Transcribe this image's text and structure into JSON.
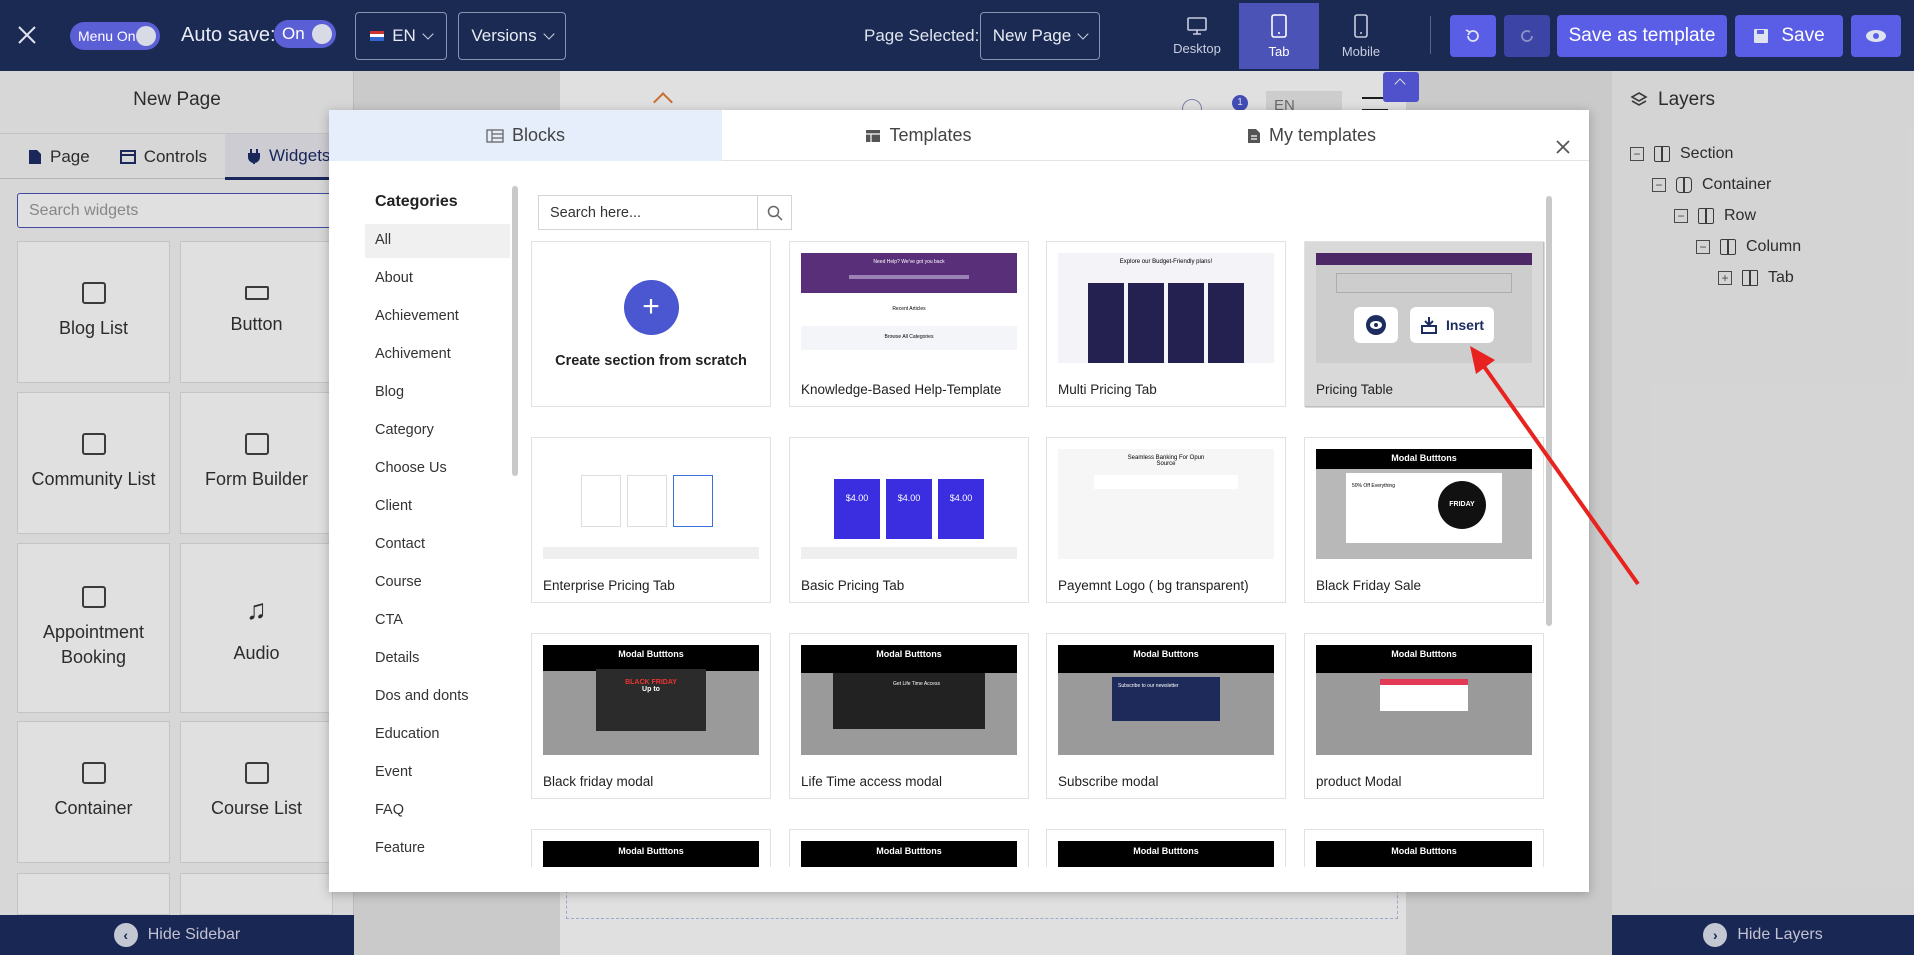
{
  "topbar": {
    "menu_toggle_label": "Menu On",
    "autosave_label": "Auto save:",
    "autosave_value": "On",
    "language": "EN",
    "versions_label": "Versions",
    "page_selected_label": "Page Selected:",
    "page_selected_value": "New Page",
    "devices": [
      {
        "label": "Desktop",
        "active": false
      },
      {
        "label": "Tab",
        "active": true
      },
      {
        "label": "Mobile",
        "active": false
      }
    ],
    "save_template_label": "Save as template",
    "save_label": "Save"
  },
  "left_panel": {
    "title": "New Page",
    "tabs": [
      {
        "label": "Page",
        "active": false
      },
      {
        "label": "Controls",
        "active": false
      },
      {
        "label": "Widgets",
        "active": true
      }
    ],
    "search_placeholder": "Search widgets",
    "widgets": [
      "Blog List",
      "Button",
      "Community List",
      "Form Builder",
      "Appointment Booking",
      "Audio",
      "Container",
      "Course List"
    ],
    "hide_label": "Hide Sidebar"
  },
  "canvas": {
    "notification_count": "1",
    "language_value": "EN"
  },
  "right_panel": {
    "title": "Layers",
    "layers": [
      "Section",
      "Container",
      "Row",
      "Column",
      "Tab"
    ],
    "hide_label": "Hide Layers"
  },
  "modal": {
    "tabs": [
      {
        "label": "Blocks",
        "active": true
      },
      {
        "label": "Templates",
        "active": false
      },
      {
        "label": "My templates",
        "active": false
      }
    ],
    "categories_title": "Categories",
    "categories": [
      "All",
      "About",
      "Achievement",
      "Achivement",
      "Blog",
      "Category",
      "Choose Us",
      "Client",
      "Contact",
      "Course",
      "CTA",
      "Details",
      "Dos and donts",
      "Education",
      "Event",
      "FAQ",
      "Feature"
    ],
    "active_category": "All",
    "search_placeholder": "Search here...",
    "create_label": "Create section from scratch",
    "templates": [
      "Knowledge-Based Help-Template",
      "Multi Pricing Tab",
      "Pricing Table",
      "Enterprise Pricing Tab",
      "Basic Pricing Tab",
      "Payemnt Logo ( bg transparent)",
      "Black Friday Sale",
      "Black friday modal",
      "Life Time access modal",
      "Subscribe modal",
      "product Modal"
    ],
    "insert_label": "Insert",
    "thumb_texts": {
      "help": "Need Help? We've got you back",
      "recent": "Recent Articles",
      "browse": "Browse All Categories",
      "budget": "Explore our Budget-Friendly plans!",
      "price": "$4.00",
      "banking": "Seamless Banking For Opun Source",
      "modal_title": "Modal Butttons",
      "black_friday": "BLACK FRIDAY",
      "friday": "FRIDAY",
      "discount": "50% Off Everything",
      "subscribe": "Subscribe to our newsletter",
      "lifetime": "Get Life Time Access",
      "upto": "Up to"
    }
  },
  "colors": {
    "topbar": "#1b2a52",
    "accent": "#5a5ee6",
    "annotation_arrow": "#e8231f"
  }
}
